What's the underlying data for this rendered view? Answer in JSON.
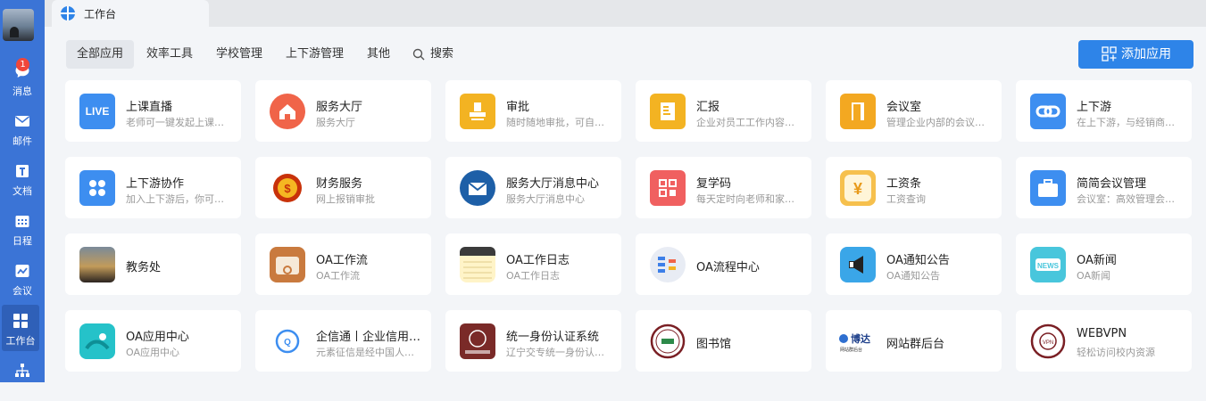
{
  "sidebar": {
    "badge_count": "1",
    "items": [
      {
        "label": "消息",
        "icon": "chat-icon"
      },
      {
        "label": "邮件",
        "icon": "mail-icon"
      },
      {
        "label": "文档",
        "icon": "document-icon"
      },
      {
        "label": "日程",
        "icon": "calendar-icon"
      },
      {
        "label": "会议",
        "icon": "meeting-icon"
      },
      {
        "label": "工作台",
        "icon": "workbench-icon"
      },
      {
        "label": "",
        "icon": "org-chart-icon"
      }
    ]
  },
  "tab": {
    "label": "工作台"
  },
  "filters": {
    "all": "全部应用",
    "efficiency": "效率工具",
    "school": "学校管理",
    "updown": "上下游管理",
    "other": "其他",
    "search": "搜索"
  },
  "add_button": {
    "label": "添加应用"
  },
  "apps": [
    {
      "title": "上课直播",
      "desc": "老师可一键发起上课直播",
      "icon": "live-icon"
    },
    {
      "title": "服务大厅",
      "desc": "服务大厅",
      "icon": "home-icon"
    },
    {
      "title": "审批",
      "desc": "随时随地审批，可自定义审批",
      "icon": "stamp-icon"
    },
    {
      "title": "汇报",
      "desc": "企业对员工工作内容的汇报",
      "icon": "report-icon"
    },
    {
      "title": "会议室",
      "desc": "管理企业内部的会议室资源",
      "icon": "door-icon"
    },
    {
      "title": "上下游",
      "desc": "在上下游，与经销商合作",
      "icon": "link-icon"
    },
    {
      "title": "上下游协作",
      "desc": "加入上下游后，你可以协作",
      "icon": "grid-icon"
    },
    {
      "title": "财务服务",
      "desc": "网上报销审批",
      "icon": "coin-icon"
    },
    {
      "title": "服务大厅消息中心",
      "desc": "服务大厅消息中心",
      "icon": "envelope-icon"
    },
    {
      "title": "复学码",
      "desc": "每天定时向老师和家长推送",
      "icon": "qr-icon"
    },
    {
      "title": "工资条",
      "desc": "工资查询",
      "icon": "yen-icon"
    },
    {
      "title": "简简会议管理",
      "desc": "会议室：高效管理会议室",
      "icon": "briefcase-icon"
    },
    {
      "title": "教务处",
      "desc": "",
      "icon": "photo-icon"
    },
    {
      "title": "OA工作流",
      "desc": "OA工作流",
      "icon": "workflow-icon"
    },
    {
      "title": "OA工作日志",
      "desc": "OA工作日志",
      "icon": "notes-icon"
    },
    {
      "title": "OA流程中心",
      "desc": "",
      "icon": "flow-icon"
    },
    {
      "title": "OA通知公告",
      "desc": "OA通知公告",
      "icon": "megaphone-icon"
    },
    {
      "title": "OA新闻",
      "desc": "OA新闻",
      "icon": "news-icon"
    },
    {
      "title": "OA应用中心",
      "desc": "OA应用中心",
      "icon": "app-center-icon"
    },
    {
      "title": "企信通丨企业信用查询",
      "desc": "元素征信是经中国人民银行",
      "icon": "credit-icon"
    },
    {
      "title": "统一身份认证系统",
      "desc": "辽宁交专统一身份认证系统",
      "icon": "identity-icon"
    },
    {
      "title": "图书馆",
      "desc": "",
      "icon": "library-icon"
    },
    {
      "title": "网站群后台",
      "desc": "",
      "icon": "boda-logo-icon"
    },
    {
      "title": "WEBVPN",
      "desc": "轻松访问校内资源",
      "icon": "vpn-icon"
    }
  ]
}
